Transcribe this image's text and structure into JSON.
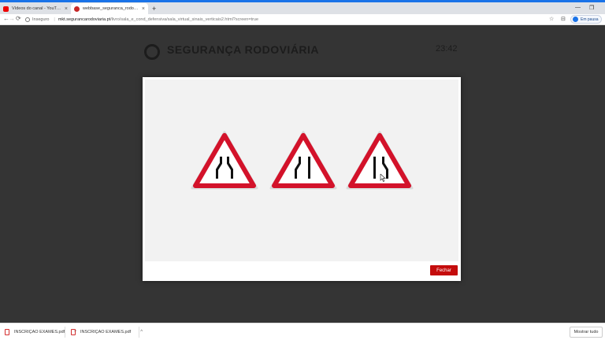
{
  "browser": {
    "tabs": [
      {
        "label": "Vídeos do canal - YouTube Studio",
        "close": "×"
      },
      {
        "label": "webbase_seguranca_rodoviaria",
        "close": "×"
      }
    ],
    "new_tab": "+",
    "window_controls": {
      "minimize": "—",
      "maximize": "❐"
    },
    "nav": {
      "back": "←",
      "forward": "→",
      "reload": "⟳"
    },
    "address": {
      "security_label": "Inseguro",
      "separator": "|",
      "host": "mkt.segurancarodoviaria.pt",
      "path": "/livro/sala_e_cond_defensiva/sala_virtual_sinais_verticais2.html?screen=true"
    },
    "toolbar_icons": {
      "star": "☆",
      "cast": "⊟"
    },
    "profile_button": "Em pausa",
    "menu": "⋮"
  },
  "background_page": {
    "title": "SEGURANÇA RODOVIÁRIA",
    "time": "23:42"
  },
  "modal": {
    "signs": [
      {
        "icon": "road-narrows-both-sides-icon"
      },
      {
        "icon": "road-narrows-left-icon"
      },
      {
        "icon": "road-narrows-right-icon"
      }
    ],
    "close_label": "Fechar",
    "colors": {
      "sign_border": "#d3122a",
      "close_button": "#c40c0c"
    }
  },
  "downloads": {
    "items": [
      {
        "label": "INSCRIÇAO EXAMES.pdf",
        "chevron": "^"
      },
      {
        "label": "INSCRIÇAO EXAMES.pdf",
        "chevron": "^"
      }
    ],
    "show_all": "Mostrar tudo",
    "close": "×"
  }
}
